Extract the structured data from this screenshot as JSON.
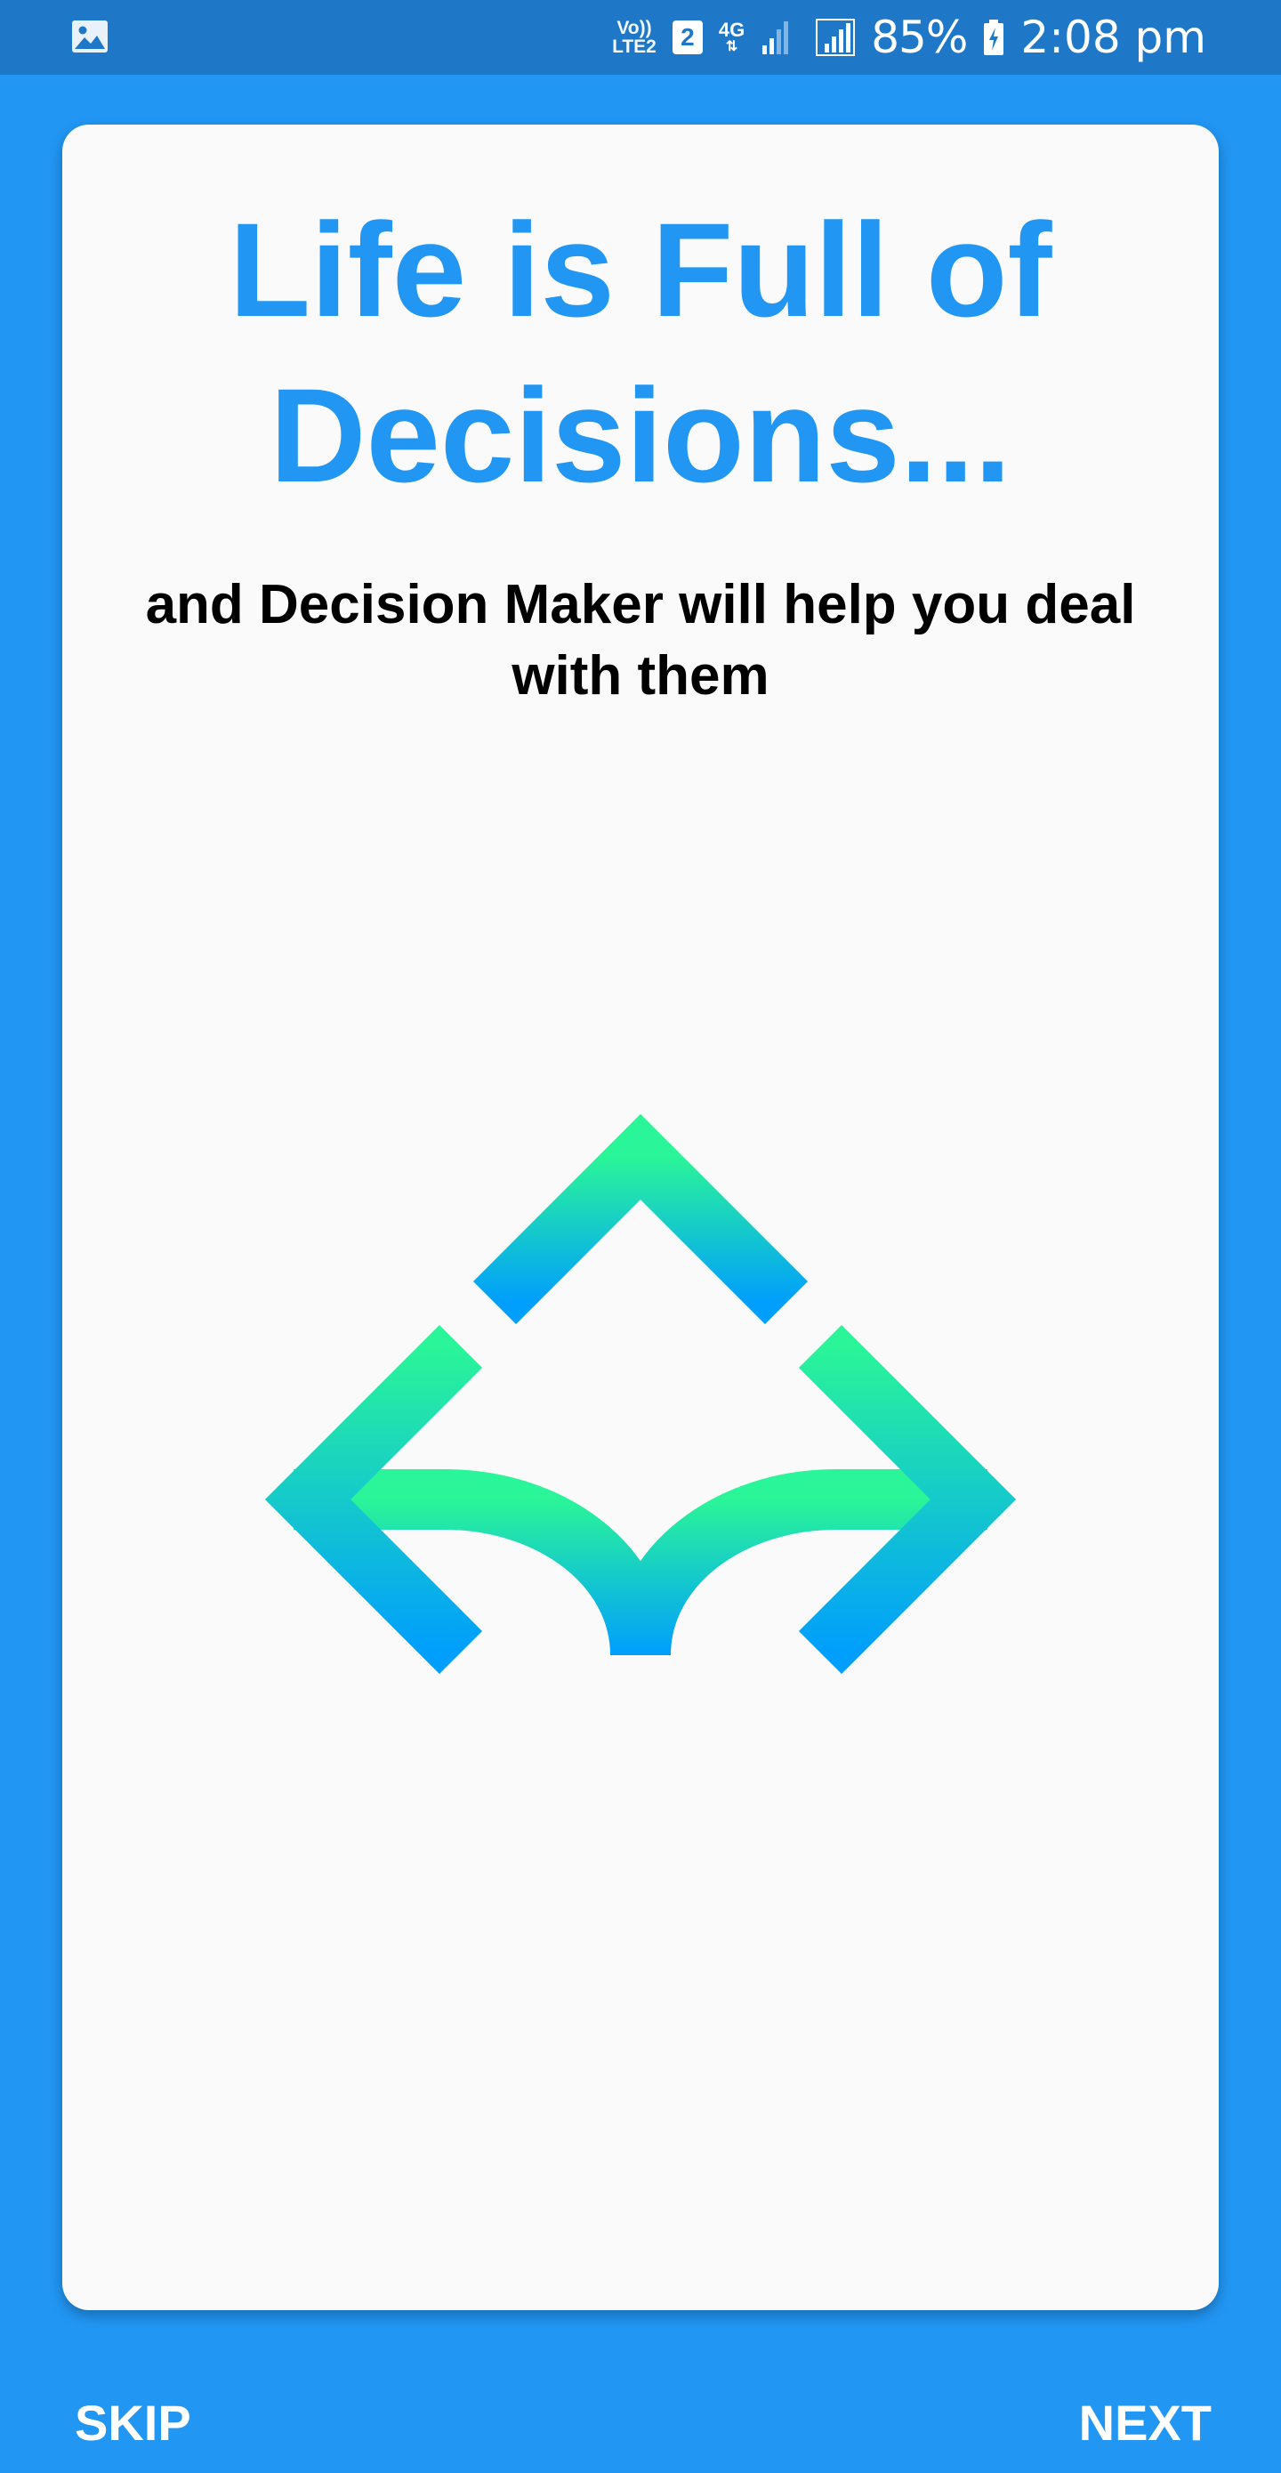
{
  "status_bar": {
    "left_icon": "gallery-image-icon",
    "volte_line1": "Vo))",
    "volte_line2": "LTE2",
    "sim_number": "2",
    "network_type": "4G",
    "signal_icon": "signal-strength-icon",
    "battery_percent": "85%",
    "battery_icon": "battery-charging-icon",
    "time": "2:08 pm"
  },
  "card": {
    "title_line1": "Life is Full of",
    "title_line2": "Decisions...",
    "subtitle": "and Decision Maker will help you deal with them",
    "illustration_icon": "three-way-arrows-icon"
  },
  "navigation": {
    "skip_label": "SKIP",
    "next_label": "NEXT"
  },
  "colors": {
    "background": "#2196F3",
    "status_bar": "#1E78C7",
    "card": "#FAFAFA",
    "title": "#2196F3",
    "arrow_gradient_top": "#2AF598",
    "arrow_gradient_bottom": "#009EFD"
  }
}
